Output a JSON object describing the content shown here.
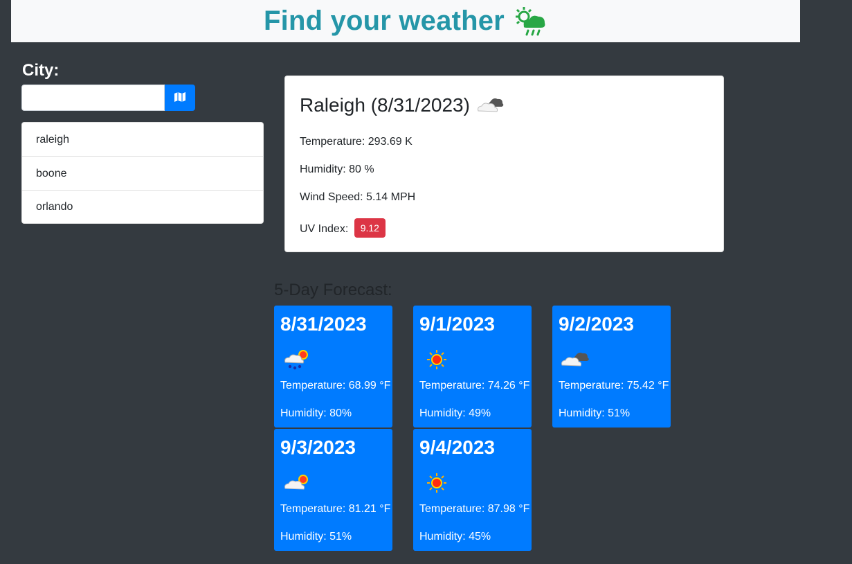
{
  "header": {
    "title": "Find your weather",
    "icon": "sun-cloud-rain-icon"
  },
  "search": {
    "label": "City:",
    "value": "",
    "placeholder": "",
    "button_icon": "map-icon"
  },
  "history": [
    {
      "label": "raleigh"
    },
    {
      "label": "boone"
    },
    {
      "label": "orlando"
    }
  ],
  "current": {
    "title": "Raleigh (8/31/2023)",
    "icon": "cloud-icon",
    "temperature": "Temperature: 293.69 K",
    "humidity": "Humidity: 80 %",
    "wind": "Wind Speed: 5.14 MPH",
    "uv_label": "UV Index:",
    "uv_value": "9.12",
    "uv_color": "#dc3545"
  },
  "forecast": {
    "heading": "5-Day Forecast:",
    "days": [
      {
        "date": "8/31/2023",
        "icon": "rain-sun-icon",
        "temperature": "Temperature: 68.99 °F",
        "humidity": "Humidity: 80%"
      },
      {
        "date": "9/1/2023",
        "icon": "sun-icon",
        "temperature": "Temperature: 74.26 °F",
        "humidity": "Humidity: 49%"
      },
      {
        "date": "9/2/2023",
        "icon": "cloud-icon",
        "temperature": "Temperature: 75.42 °F",
        "humidity": "Humidity: 51%"
      },
      {
        "date": "9/3/2023",
        "icon": "cloud-sun-icon",
        "temperature": "Temperature: 81.21 °F",
        "humidity": "Humidity: 51%"
      },
      {
        "date": "9/4/2023",
        "icon": "sun-icon",
        "temperature": "Temperature: 87.98 °F",
        "humidity": "Humidity: 45%"
      }
    ]
  },
  "colors": {
    "background": "#343a40",
    "accent": "#007bff",
    "title": "#2596a8",
    "danger": "#dc3545"
  }
}
